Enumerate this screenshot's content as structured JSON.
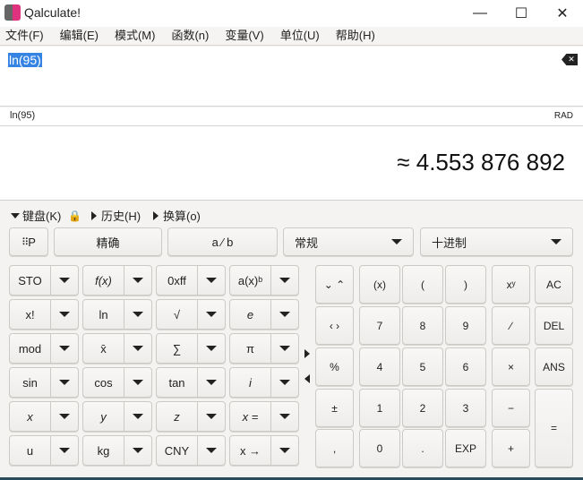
{
  "window": {
    "title": "Qalculate!",
    "minimize": "—",
    "maximize": "☐",
    "close": "✕"
  },
  "menu": [
    "文件(F)",
    "编辑(E)",
    "模式(M)",
    "函数(n)",
    "变量(V)",
    "单位(U)",
    "帮助(H)"
  ],
  "input": {
    "expression": "ln(95)",
    "clear_icon": "backspace-clear-icon"
  },
  "status": {
    "parsed": "ln(95)",
    "angle_mode": "RAD"
  },
  "result": {
    "value": "≈ 4.553 876 892"
  },
  "expanders": {
    "keyboard": "键盘(K)",
    "history": "历史(H)",
    "conversion": "换算(o)"
  },
  "toolbar": {
    "grid_label": "P",
    "exact": "精确",
    "fraction": "a ⁄ b",
    "format": "常规",
    "base": "十进制"
  },
  "left_keys": [
    [
      "STO",
      "f(x)",
      "0xff",
      "a(x)ᵇ"
    ],
    [
      "x!",
      "ln",
      "√",
      "e"
    ],
    [
      "mod",
      "x̄",
      "∑",
      "π"
    ],
    [
      "sin",
      "cos",
      "tan",
      "i"
    ],
    [
      "x",
      "y",
      "z",
      "x ="
    ],
    [
      "u",
      "kg",
      "CNY",
      "x →"
    ]
  ],
  "right_keys": [
    [
      "⌄ ⌃",
      "(x)",
      "(",
      ")",
      "xʸ",
      "AC"
    ],
    [
      "‹ ›",
      "7",
      "8",
      "9",
      "∕",
      "DEL"
    ],
    [
      "%",
      "4",
      "5",
      "6",
      "×",
      "ANS"
    ],
    [
      "±",
      "1",
      "2",
      "3",
      "−",
      "="
    ],
    [
      ",",
      "0",
      ".",
      "EXP",
      "+",
      ""
    ]
  ]
}
